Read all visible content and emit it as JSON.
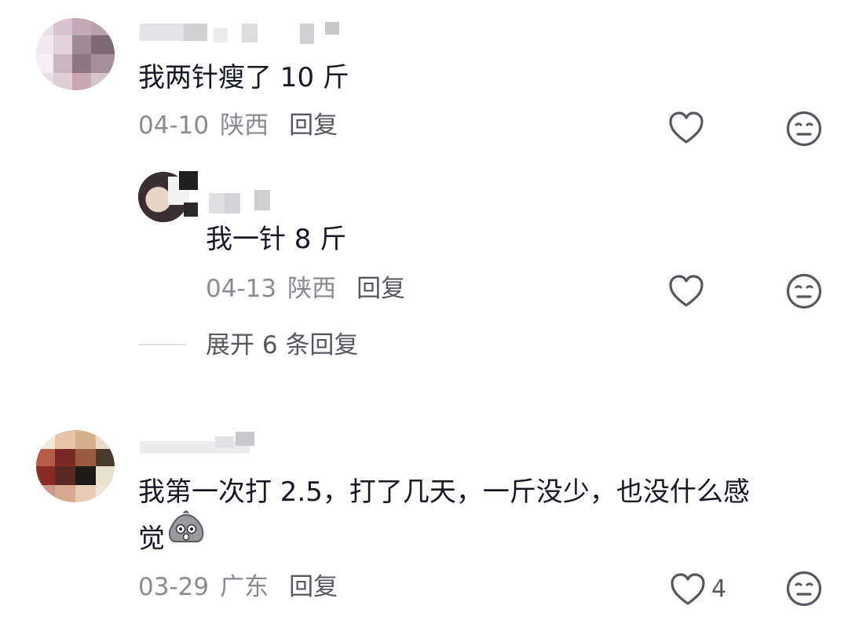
{
  "comments": [
    {
      "text": "我两针瘦了 10 斤",
      "date": "04-10",
      "location": "陕西",
      "reply_label": "回复",
      "like_count": "",
      "replies": [
        {
          "text": "我一针 8 斤",
          "date": "04-13",
          "location": "陕西",
          "reply_label": "回复",
          "like_count": ""
        }
      ],
      "expand_label": "展开 6 条回复"
    },
    {
      "text_line1": "我第一次打 2.5，打了几天，一斤没少，也没什么感",
      "text_line2": "觉",
      "date": "03-29",
      "location": "广东",
      "reply_label": "回复",
      "like_count": "4"
    }
  ],
  "icons": {
    "like": "heart-outline-icon",
    "dislike": "meh-face-icon",
    "emoji": "scared-blob-emoji"
  },
  "colors": {
    "text": "#161823",
    "meta": "#8a8b91",
    "secondary": "#57585f"
  }
}
